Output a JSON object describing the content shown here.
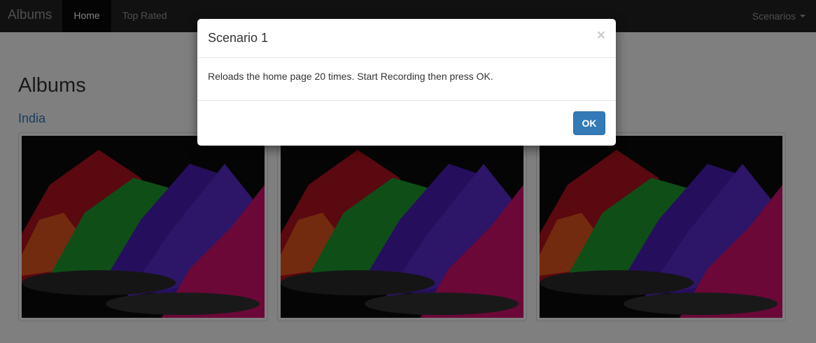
{
  "navbar": {
    "brand": "Albums",
    "items": [
      {
        "label": "Home",
        "active": true
      },
      {
        "label": "Top Rated",
        "active": false
      }
    ],
    "right_menu": {
      "label": "Scenarios"
    }
  },
  "page": {
    "title": "Albums",
    "album": {
      "name": "India",
      "photo_count_visible": 3,
      "photo_subject": "colored powder piles"
    }
  },
  "modal": {
    "title": "Scenario 1",
    "close_symbol": "×",
    "body": "Reloads the home page 20 times. Start Recording then press OK.",
    "ok_label": "OK"
  },
  "colors": {
    "navbar_bg": "#222222",
    "link": "#337ab7",
    "primary_button": "#337ab7"
  }
}
